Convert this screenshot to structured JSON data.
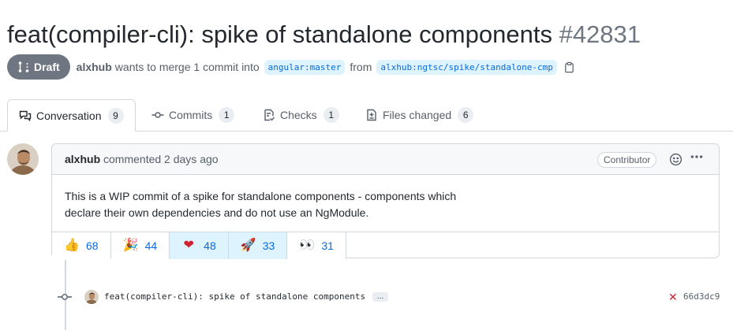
{
  "pr": {
    "title": "feat(compiler-cli): spike of standalone components",
    "number": "#42831",
    "status": "Draft",
    "author": "alxhub",
    "merge_text": "wants to merge 1 commit into",
    "base_branch": "angular:master",
    "from_text": "from",
    "head_branch": "alxhub:ngtsc/spike/standalone-cmp"
  },
  "tabs": [
    {
      "label": "Conversation",
      "count": "9",
      "icon": "comment-discussion-icon",
      "active": true
    },
    {
      "label": "Commits",
      "count": "1",
      "icon": "git-commit-icon"
    },
    {
      "label": "Checks",
      "count": "1",
      "icon": "checklist-icon"
    },
    {
      "label": "Files changed",
      "count": "6",
      "icon": "file-diff-icon"
    }
  ],
  "comment": {
    "author": "alxhub",
    "action": "commented 2 days ago",
    "role_badge": "Contributor",
    "body_line1": "This is a WIP commit of a spike for standalone components - components which",
    "body_line2": "declare their own dependencies and do not use an NgModule.",
    "reactions": [
      {
        "emoji": "👍",
        "icon": "thumbs-up-icon",
        "count": "68",
        "reacted": false
      },
      {
        "emoji": "🎉",
        "icon": "tada-icon",
        "count": "44",
        "reacted": false
      },
      {
        "emoji": "❤",
        "icon": "heart-icon",
        "count": "48",
        "reacted": true
      },
      {
        "emoji": "🚀",
        "icon": "rocket-icon",
        "count": "33",
        "reacted": true
      },
      {
        "emoji": "👀",
        "icon": "eyes-icon",
        "count": "31",
        "reacted": false
      }
    ]
  },
  "commit": {
    "message": "feat(compiler-cli): spike of standalone components",
    "ellipsis": "…",
    "status_icon": "x-icon",
    "sha": "66d3dc9"
  },
  "colors": {
    "draft_badge": "#6e7781",
    "link_blue": "#0969da",
    "branch_bg": "#ddf4ff",
    "fail_red": "#cf222e",
    "border": "#d0d7de"
  }
}
